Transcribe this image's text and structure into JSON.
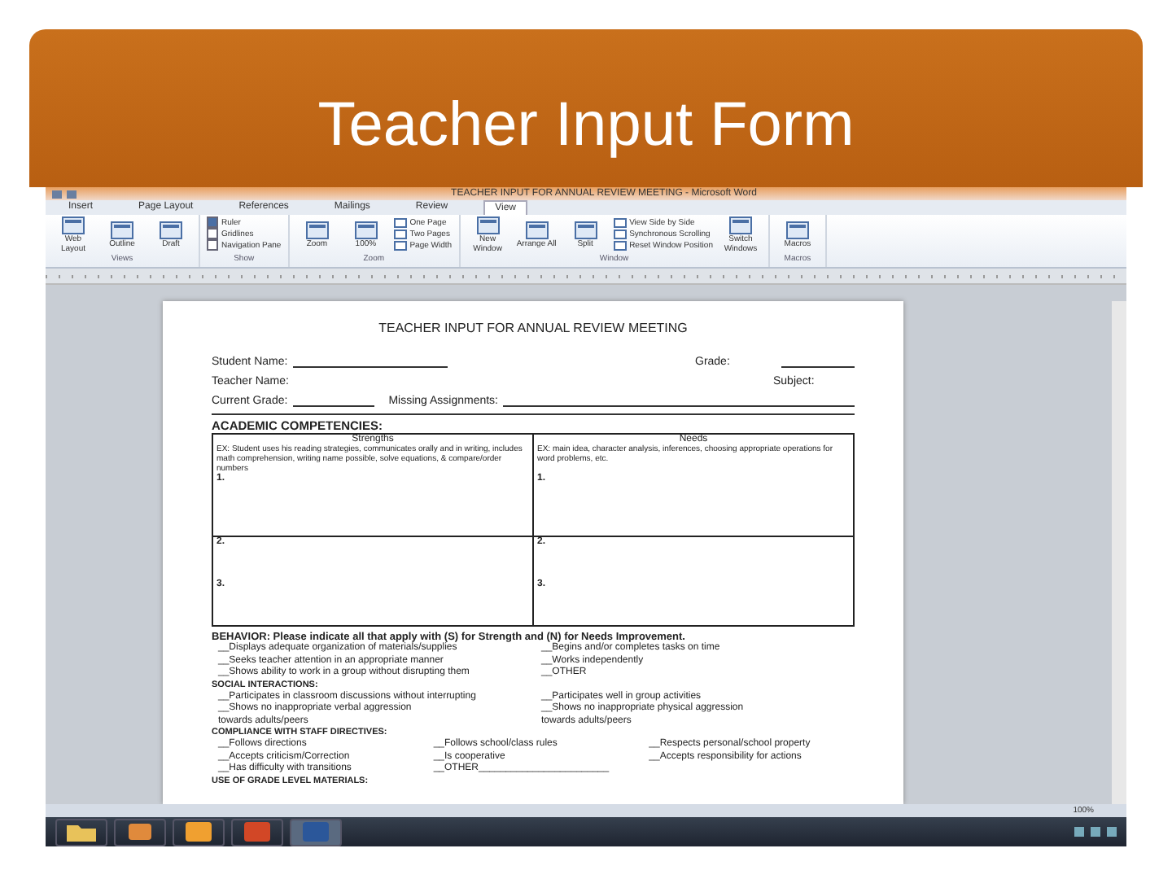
{
  "slide_title": "Teacher Input Form",
  "word": {
    "title_bar": "TEACHER INPUT FOR ANNUAL REVIEW MEETING - Microsoft Word",
    "tabs": [
      {
        "label": "Insert",
        "selected": false
      },
      {
        "label": "Page Layout",
        "selected": false
      },
      {
        "label": "References",
        "selected": false
      },
      {
        "label": "Mailings",
        "selected": false
      },
      {
        "label": "Review",
        "selected": false
      },
      {
        "label": "View",
        "selected": true
      }
    ],
    "ribbon_groups": [
      {
        "label": "Views",
        "items": [
          {
            "kind": "large",
            "label": "Web Layout"
          },
          {
            "kind": "large",
            "label": "Outline"
          },
          {
            "kind": "large",
            "label": "Draft"
          }
        ]
      },
      {
        "label": "Show",
        "items": [
          {
            "kind": "check",
            "label": "Ruler",
            "checked": true
          },
          {
            "kind": "check",
            "label": "Gridlines",
            "checked": false
          },
          {
            "kind": "check",
            "label": "Navigation Pane",
            "checked": false
          }
        ]
      },
      {
        "label": "Zoom",
        "items": [
          {
            "kind": "large",
            "label": "Zoom"
          },
          {
            "kind": "large",
            "label": "100%"
          },
          {
            "kind": "small",
            "label": "One Page"
          },
          {
            "kind": "small",
            "label": "Two Pages"
          },
          {
            "kind": "small",
            "label": "Page Width"
          }
        ]
      },
      {
        "label": "Window",
        "items": [
          {
            "kind": "large",
            "label": "New Window"
          },
          {
            "kind": "large",
            "label": "Arrange All"
          },
          {
            "kind": "large",
            "label": "Split"
          },
          {
            "kind": "small",
            "label": "View Side by Side"
          },
          {
            "kind": "small",
            "label": "Synchronous Scrolling"
          },
          {
            "kind": "small",
            "label": "Reset Window Position"
          },
          {
            "kind": "large",
            "label": "Switch Windows"
          }
        ]
      },
      {
        "label": "Macros",
        "items": [
          {
            "kind": "large",
            "label": "Macros"
          }
        ]
      }
    ],
    "document": {
      "heading": "TEACHER INPUT FOR ANNUAL REVIEW MEETING",
      "fields": [
        {
          "label": "Student Name:",
          "label2": "Grade:"
        },
        {
          "label": "Teacher Name:",
          "label2": "Subject:"
        }
      ],
      "grade_line": {
        "label": "Current Grade:",
        "label2": "Missing Assignments:"
      },
      "section": "ACADEMIC  COMPETENCIES:",
      "table": {
        "columns": [
          "Strengths",
          "Needs"
        ],
        "examples": [
          "EX: Student uses his reading strategies, communicates orally and in writing, includes math comprehension, writing name possible, solve equations, & compare/order numbers",
          "EX: main idea, character analysis, inferences, choosing appropriate operations for word problems, etc."
        ],
        "rows": [
          [
            "1.",
            "1."
          ],
          [
            "2.",
            "2."
          ],
          [
            "3.",
            "3."
          ]
        ]
      },
      "behavior": {
        "heading": "BEHAVIOR: Please indicate all that apply with (S) for Strength and (N) for Needs Improvement.",
        "groups": [
          {
            "kind": "pairs",
            "items": [
              "__Displays adequate organization of materials/supplies",
              "__Begins and/or completes tasks on time",
              "__Seeks teacher attention in an appropriate manner",
              "__Works independently",
              "__Shows ability to work in a group without disrupting them",
              "__OTHER"
            ]
          },
          {
            "title": "SOCIAL INTERACTIONS:",
            "kind": "pairs",
            "items": [
              "__Participates in classroom discussions without interrupting",
              "__Participates well in group activities",
              "__Shows no inappropriate verbal aggression",
              "__Shows no inappropriate physical aggression",
              "towards adults/peers",
              "towards adults/peers"
            ]
          },
          {
            "title": "COMPLIANCE WITH STAFF DIRECTIVES:",
            "kind": "triples",
            "items": [
              "__Follows directions",
              "__Follows school/class rules",
              "__Respects personal/school property",
              "__Accepts criticism/Correction",
              "__Is cooperative",
              "__Accepts responsibility for actions",
              "__Has difficulty with transitions",
              "__OTHER________________________"
            ]
          },
          {
            "title": "USE OF GRADE LEVEL MATERIALS:"
          }
        ]
      }
    },
    "status_bar": {
      "zoom": "100%"
    }
  }
}
